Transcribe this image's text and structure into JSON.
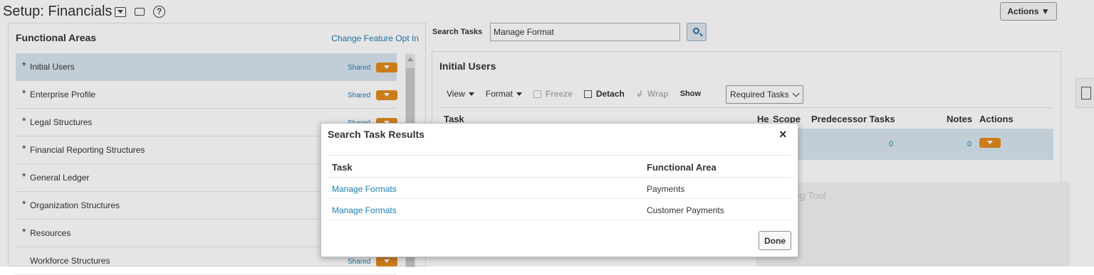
{
  "header": {
    "title": "Setup: Financials",
    "actions_label": "Actions ▼"
  },
  "left_panel": {
    "title": "Functional Areas",
    "change_feature_link": "Change Feature Opt In",
    "items": [
      {
        "label": "Initial Users",
        "required": "*",
        "shared": "Shared"
      },
      {
        "label": "Enterprise Profile",
        "required": "*",
        "shared": "Shared"
      },
      {
        "label": "Legal Structures",
        "required": "*",
        "shared": "Shared"
      },
      {
        "label": "Financial Reporting Structures",
        "required": "*",
        "shared": ""
      },
      {
        "label": "General Ledger",
        "required": "*",
        "shared": ""
      },
      {
        "label": "Organization Structures",
        "required": "*",
        "shared": ""
      },
      {
        "label": "Resources",
        "required": "*",
        "shared": ""
      },
      {
        "label": "Workforce Structures",
        "required": "",
        "shared": "Shared"
      }
    ]
  },
  "search": {
    "label": "Search Tasks",
    "value": "Manage Format"
  },
  "right_panel": {
    "title": "Initial Users",
    "toolbar": {
      "view": "View",
      "format": "Format",
      "freeze": "Freeze",
      "detach": "Detach",
      "wrap": "Wrap",
      "show": "Show",
      "show_value": "Required Tasks"
    },
    "columns": {
      "task": "Task",
      "he": "He",
      "scope": "Scope",
      "predecessor": "Predecessor Tasks",
      "notes": "Notes",
      "actions": "Actions"
    },
    "row": {
      "predecessor": "0",
      "notes": "0"
    }
  },
  "snipping_tool": "Snipping Tool",
  "modal": {
    "title": "Search Task Results",
    "close": "×",
    "columns": {
      "task": "Task",
      "functional_area": "Functional Area"
    },
    "rows": [
      {
        "task": "Manage Formats",
        "functional_area": "Payments"
      },
      {
        "task": "Manage Formats",
        "functional_area": "Customer Payments"
      }
    ],
    "done_label": "Done"
  },
  "colors": {
    "link": "#1f7db2",
    "selected_row": "#d8e6f0",
    "action_button": "#e18b1f"
  }
}
